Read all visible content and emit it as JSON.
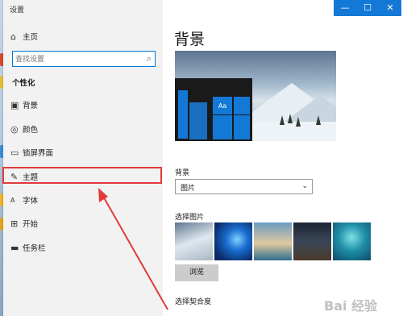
{
  "window": {
    "title": "设置",
    "controls": [
      "—",
      "☐",
      "✕"
    ]
  },
  "sidebar": {
    "home": {
      "icon": "home-icon",
      "label": "主页"
    },
    "search": {
      "placeholder": "查找设置",
      "icon": "search-icon"
    },
    "group_title": "个性化",
    "items": [
      {
        "icon": "image-icon",
        "label": "背景"
      },
      {
        "icon": "palette-icon",
        "label": "颜色"
      },
      {
        "icon": "monitor-lock-icon",
        "label": "锁屏界面"
      },
      {
        "icon": "theme-brush-icon",
        "label": "主题"
      },
      {
        "icon": "font-icon",
        "label": "字体"
      },
      {
        "icon": "start-grid-icon",
        "label": "开始"
      },
      {
        "icon": "taskbar-icon",
        "label": "任务栏"
      }
    ]
  },
  "main": {
    "page_title": "背景",
    "preview": {
      "tile_text": "Aa"
    },
    "background_label": "背景",
    "background_select": "图片",
    "choose_picture_label": "选择图片",
    "thumbnails": [
      "snowy-mountain",
      "windows-blue",
      "beach-rock",
      "night-sky",
      "underwater"
    ],
    "browse_label": "浏览",
    "fit_label": "选择契合度"
  },
  "annotation": {
    "highlight_color": "#e23b3b"
  },
  "watermark": "Bai 经验"
}
